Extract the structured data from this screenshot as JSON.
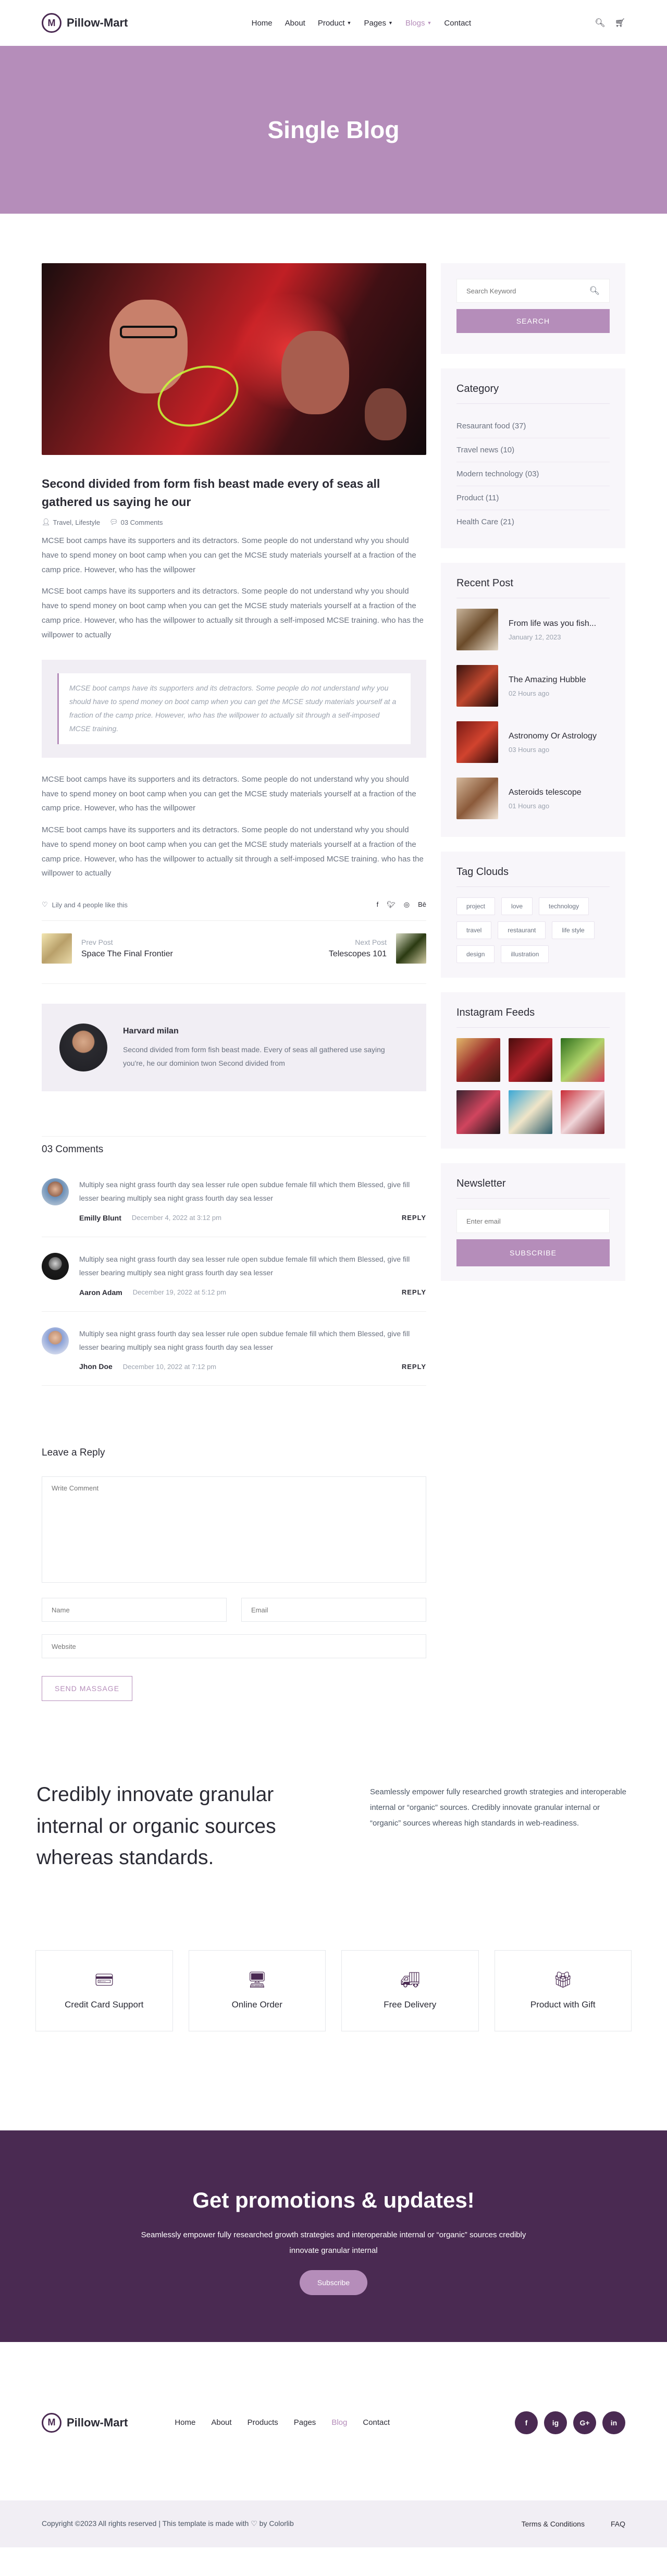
{
  "brand": {
    "name": "Pillow-Mart",
    "accent": "#b58dba",
    "dark": "#4a2a52"
  },
  "nav": [
    {
      "label": "Home"
    },
    {
      "label": "About"
    },
    {
      "label": "Product"
    },
    {
      "label": "Pages"
    },
    {
      "label": "Blogs"
    },
    {
      "label": "Contact"
    }
  ],
  "hero": {
    "title": "Single Blog"
  },
  "post": {
    "title": "Second divided from form fish beast made every of seas all gathered us saying he our",
    "categories": "Travel, Lifestyle",
    "comments_count": "03 Comments",
    "para1": "MCSE boot camps have its supporters and its detractors. Some people do not understand why you should have to spend money on boot camp when you can get the MCSE study materials yourself at a fraction of the camp price. However, who has the willpower",
    "para2": "MCSE boot camps have its supporters and its detractors. Some people do not understand why you should have to spend money on boot camp when you can get the MCSE study materials yourself at a fraction of the camp price. However, who has the willpower to actually sit through a self-imposed MCSE training. who has the willpower to actually",
    "quote": "MCSE boot camps have its supporters and its detractors. Some people do not understand why you should have to spend money on boot camp when you can get the MCSE study materials yourself at a fraction of the camp price. However, who has the willpower to actually sit through a self-imposed MCSE training.",
    "para3": "MCSE boot camps have its supporters and its detractors. Some people do not understand why you should have to spend money on boot camp when you can get the MCSE study materials yourself at a fraction of the camp price. However, who has the willpower",
    "para4": "MCSE boot camps have its supporters and its detractors. Some people do not understand why you should have to spend money on boot camp when you can get the MCSE study materials yourself at a fraction of the camp price. However, who has the willpower to actually sit through a self-imposed MCSE training. who has the willpower to actually",
    "likes": "Lily and 4 people like this"
  },
  "post_nav": {
    "prev_label": "Prev Post",
    "prev_title": "Space The Final Frontier",
    "next_label": "Next Post",
    "next_title": "Telescopes 101"
  },
  "author": {
    "name": "Harvard milan",
    "bio": "Second divided from form fish beast made. Every of seas all gathered use saying you're, he our dominion twon Second divided from"
  },
  "comments": {
    "title": "03 Comments",
    "items": [
      {
        "text": "Multiply sea night grass fourth day sea lesser rule open subdue female fill which them Blessed, give fill lesser bearing multiply sea night grass fourth day sea lesser",
        "name": "Emilly Blunt",
        "date": "December 4, 2022 at 3:12 pm",
        "reply": "REPLY"
      },
      {
        "text": "Multiply sea night grass fourth day sea lesser rule open subdue female fill which them Blessed, give fill lesser bearing multiply sea night grass fourth day sea lesser",
        "name": "Aaron Adam",
        "date": "December 19, 2022 at 5:12 pm",
        "reply": "REPLY"
      },
      {
        "text": "Multiply sea night grass fourth day sea lesser rule open subdue female fill which them Blessed, give fill lesser bearing multiply sea night grass fourth day sea lesser",
        "name": "Jhon Doe",
        "date": "December 10, 2022 at 7:12 pm",
        "reply": "REPLY"
      }
    ]
  },
  "reply_form": {
    "title": "Leave a Reply",
    "comment_placeholder": "Write Comment",
    "name_placeholder": "Name",
    "email_placeholder": "Email",
    "website_placeholder": "Website",
    "submit": "SEND MASSAGE"
  },
  "sidebar": {
    "search": {
      "placeholder": "Search Keyword",
      "button": "SEARCH"
    },
    "category": {
      "title": "Category",
      "items": [
        "Resaurant food (37)",
        "Travel news (10)",
        "Modern technology (03)",
        "Product (11)",
        "Health Care (21)"
      ]
    },
    "recent": {
      "title": "Recent Post",
      "items": [
        {
          "title": "From life was you fish...",
          "date": "January 12, 2023"
        },
        {
          "title": "The Amazing Hubble",
          "date": "02 Hours ago"
        },
        {
          "title": "Astronomy Or Astrology",
          "date": "03 Hours ago"
        },
        {
          "title": "Asteroids telescope",
          "date": "01 Hours ago"
        }
      ]
    },
    "tags": {
      "title": "Tag Clouds",
      "items": [
        "project",
        "love",
        "technology",
        "travel",
        "restaurant",
        "life style",
        "design",
        "illustration"
      ]
    },
    "instagram": {
      "title": "Instagram Feeds"
    },
    "newsletter": {
      "title": "Newsletter",
      "placeholder": "Enter email",
      "button": "SUBSCRIBE"
    }
  },
  "intro": {
    "heading": "Credibly innovate granular internal or organic sources whereas standards.",
    "text": "Seamlessly empower fully researched growth strategies and interoperable internal or “organic” sources. Credibly innovate granular internal or “organic” sources whereas high standards in web-readiness."
  },
  "features": [
    {
      "label": "Credit Card Support",
      "icon": "credit-card-icon"
    },
    {
      "label": "Online Order",
      "icon": "online-order-icon"
    },
    {
      "label": "Free Delivery",
      "icon": "delivery-truck-icon"
    },
    {
      "label": "Product with Gift",
      "icon": "gift-icon"
    }
  ],
  "promo": {
    "title": "Get promotions & updates!",
    "text": "Seamlessly empower fully researched growth strategies and interoperable internal or “organic” sources credibly innovate granular internal",
    "button": "Subscribe"
  },
  "footer": {
    "nav": [
      "Home",
      "About",
      "Products",
      "Pages",
      "Blog",
      "Contact"
    ],
    "social": [
      "f",
      "ig",
      "G+",
      "in"
    ],
    "copyright": "Copyright ©2023 All rights reserved | This template is made with",
    "by": "by Colorlib",
    "links": [
      "Terms & Conditions",
      "FAQ"
    ]
  }
}
